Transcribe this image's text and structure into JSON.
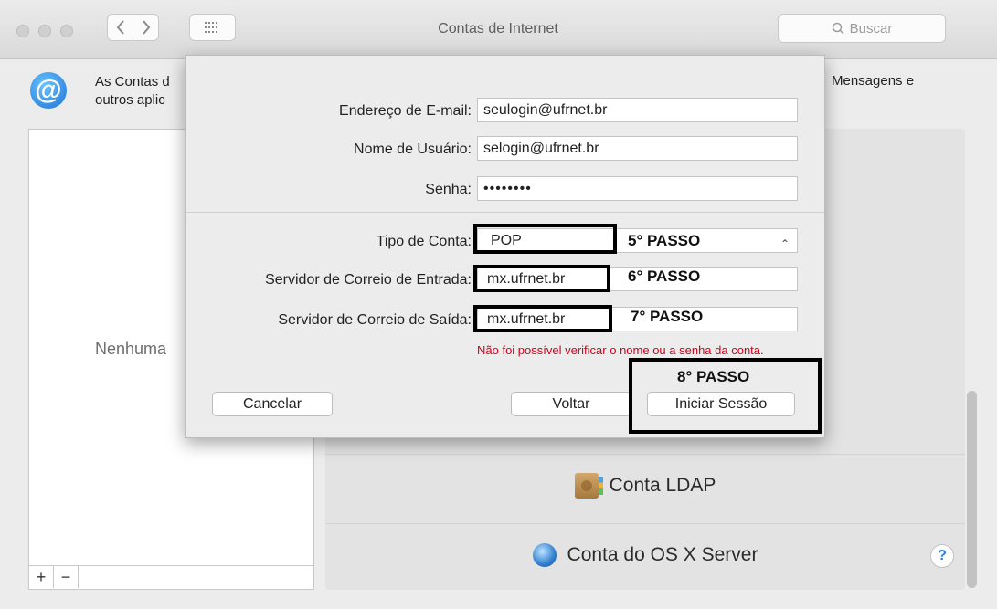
{
  "window": {
    "title": "Contas de Internet",
    "search_placeholder": "Buscar",
    "grid_icon": "grid-icon"
  },
  "pane": {
    "header_text_line1": "As Contas d",
    "header_text_line2": "outros aplic",
    "header_right": "Mensagens e",
    "empty_list_label": "Nenhuma",
    "add_label": "+",
    "remove_label": "−",
    "providers": [
      {
        "label": "Conta LDAP",
        "icon": "ldap-icon"
      },
      {
        "label": "Conta do OS X Server",
        "icon": "osx-server-icon"
      }
    ],
    "help_label": "?"
  },
  "sheet": {
    "email_label": "Endereço de E-mail:",
    "email_value": "seulogin@ufrnet.br",
    "username_label": "Nome de Usuário:",
    "username_value": "selogin@ufrnet.br",
    "password_label": "Senha:",
    "password_value": "••••••••",
    "account_type_label": "Tipo de Conta:",
    "account_type_value": "POP",
    "incoming_label": "Servidor de Correio de Entrada:",
    "incoming_value": "mx.ufrnet.br",
    "outgoing_label": "Servidor de Correio de Saída:",
    "outgoing_value": "mx.ufrnet.br",
    "error_text": "Não foi possível verificar o nome ou a senha da conta.",
    "cancel_label": "Cancelar",
    "back_label": "Voltar",
    "signin_label": "Iniciar Sessão"
  },
  "annotations": {
    "step5": "5° PASSO",
    "step6": "6° PASSO",
    "step7": "7° PASSO",
    "step8": "8° PASSO"
  }
}
